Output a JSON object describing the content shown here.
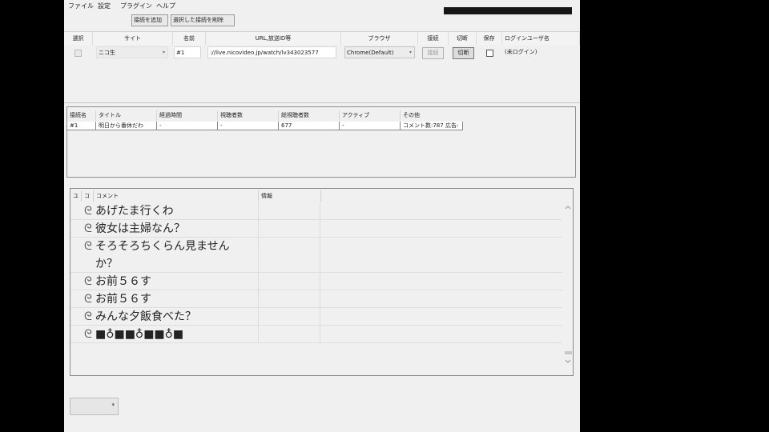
{
  "menu": [
    "ファイル",
    "設定",
    "プラグイン",
    "ヘルプ"
  ],
  "toolbar": {
    "add_label": "接続を追加",
    "remove_label": "選択した接続を削除"
  },
  "connections": {
    "headers": [
      "選択",
      "サイト",
      "名前",
      "URL,放送ID等",
      "ブラウザ",
      "接続",
      "切断",
      "保存",
      "ログインユーザ名"
    ],
    "row": {
      "site": "ニコ生",
      "name": "#1",
      "url": "://live.nicovideo.jp/watch/lv343023577",
      "browser": "Chrome(Default)",
      "connect": "接続",
      "disconnect": "切断",
      "login_user": "(未ログイン)"
    }
  },
  "info": {
    "headers": [
      "接続名",
      "タイトル",
      "経過時間",
      "視聴者数",
      "総視聴者数",
      "アクティブ",
      "その他"
    ],
    "row": [
      "#1",
      "明日から番休だわ",
      "-",
      "-",
      "677",
      "-",
      "コメント数:787 広告:"
    ]
  },
  "comments": {
    "headers": [
      "ユ",
      "コ",
      "コメント",
      "情報"
    ],
    "rows": [
      {
        "icon": "ᘓ",
        "text": "あげたま行くわ"
      },
      {
        "icon": "ᘓ",
        "text": "彼女は主婦なん？"
      },
      {
        "icon": "ᘓ",
        "text": "そろそろちくらん見ませんか？"
      },
      {
        "icon": "ᘓ",
        "text": "お前５６す"
      },
      {
        "icon": "ᘓ",
        "text": "お前５６す"
      },
      {
        "icon": "ᘓ",
        "text": "みんな夕飯食べた？"
      },
      {
        "icon": "ᘓ",
        "text": "■♁■■♁■■♁■"
      }
    ]
  },
  "progress": {
    "value": 1.0,
    "color": "#161616"
  },
  "icons": {
    "scroll_up": "up-arrow-icon",
    "scroll_down": "down-arrow-icon",
    "dropdown": "chevron-down-icon"
  }
}
